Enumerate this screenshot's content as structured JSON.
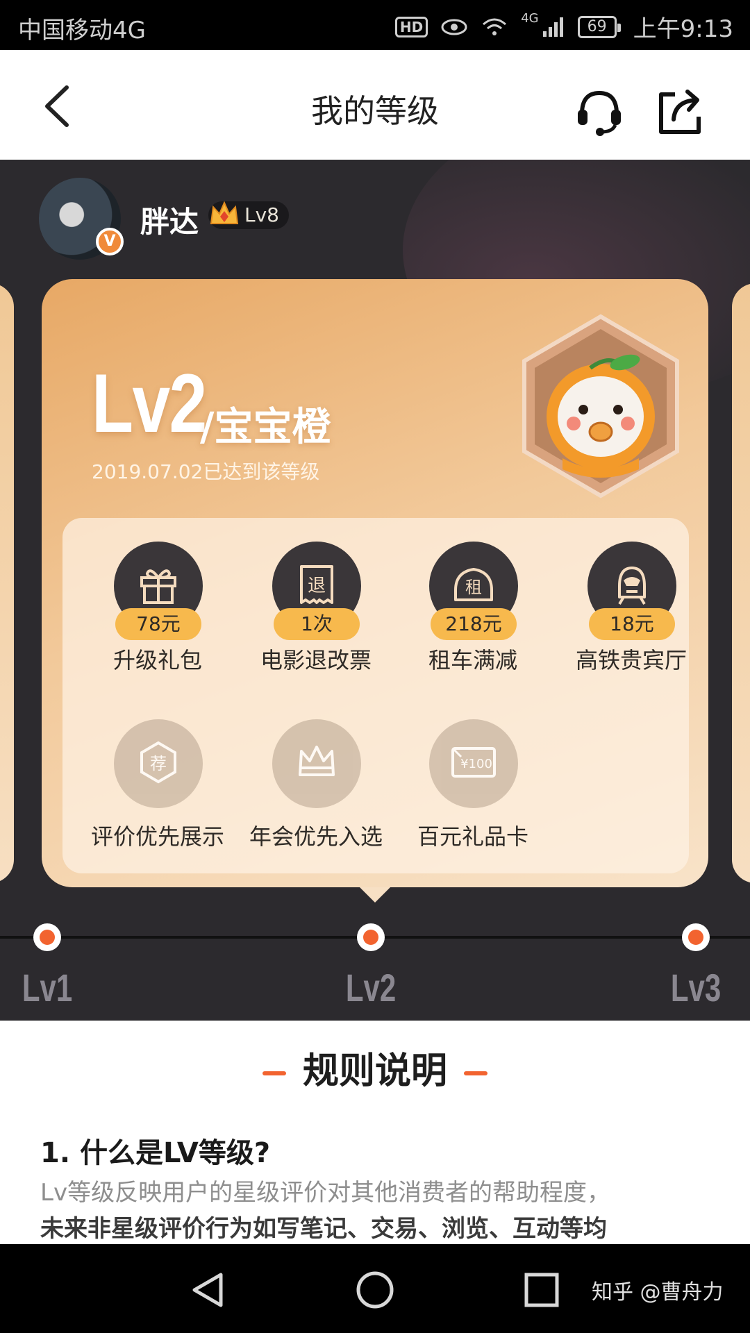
{
  "status_bar": {
    "carrier": "中国移动4G",
    "hd": "HD",
    "network": "4G",
    "battery": "69",
    "time": "上午9:13"
  },
  "header": {
    "title": "我的等级"
  },
  "user": {
    "name": "胖达",
    "avatar_badge": "V",
    "level_badge": "Lv8"
  },
  "level_card": {
    "level": "Lv2",
    "level_name": "/宝宝橙",
    "reached_text": "2019.07.02已达到该等级",
    "perks": [
      {
        "icon": "gift-icon",
        "glyph": "",
        "value": "78元",
        "label": "升级礼包",
        "active": true
      },
      {
        "icon": "refund-ticket-icon",
        "glyph": "退",
        "value": "1次",
        "label": "电影退改票",
        "active": true
      },
      {
        "icon": "car-rental-icon",
        "glyph": "租",
        "value": "218元",
        "label": "租车满减",
        "active": true
      },
      {
        "icon": "train-icon",
        "glyph": "",
        "value": "18元",
        "label": "高铁贵宾厅",
        "active": true
      },
      {
        "icon": "recommend-icon",
        "glyph": "荐",
        "value": "",
        "label": "评价优先展示",
        "active": false
      },
      {
        "icon": "crown-icon",
        "glyph": "",
        "value": "",
        "label": "年会优先入选",
        "active": false
      },
      {
        "icon": "gift-card-icon",
        "glyph": "¥100",
        "value": "",
        "label": "百元礼品卡",
        "active": false
      }
    ]
  },
  "timeline": {
    "levels": [
      "Lv1",
      "Lv2",
      "Lv3"
    ],
    "current": "Lv2"
  },
  "rules": {
    "heading": "规则说明",
    "q1_title": "1. 什么是LV等级?",
    "q1_line1": "Lv等级反映用户的星级评价对其他消费者的帮助程度，",
    "q1_line2": "未来非星级评价行为如写笔记、交易、浏览、互动等均"
  },
  "watermark": "知乎 @曹舟力",
  "colors": {
    "accent": "#f2632f",
    "chip": "#f7b94d",
    "dark_bg": "#2c2a2e",
    "card_gradient_start": "#e7a865",
    "card_gradient_end": "#f8e3c9"
  }
}
